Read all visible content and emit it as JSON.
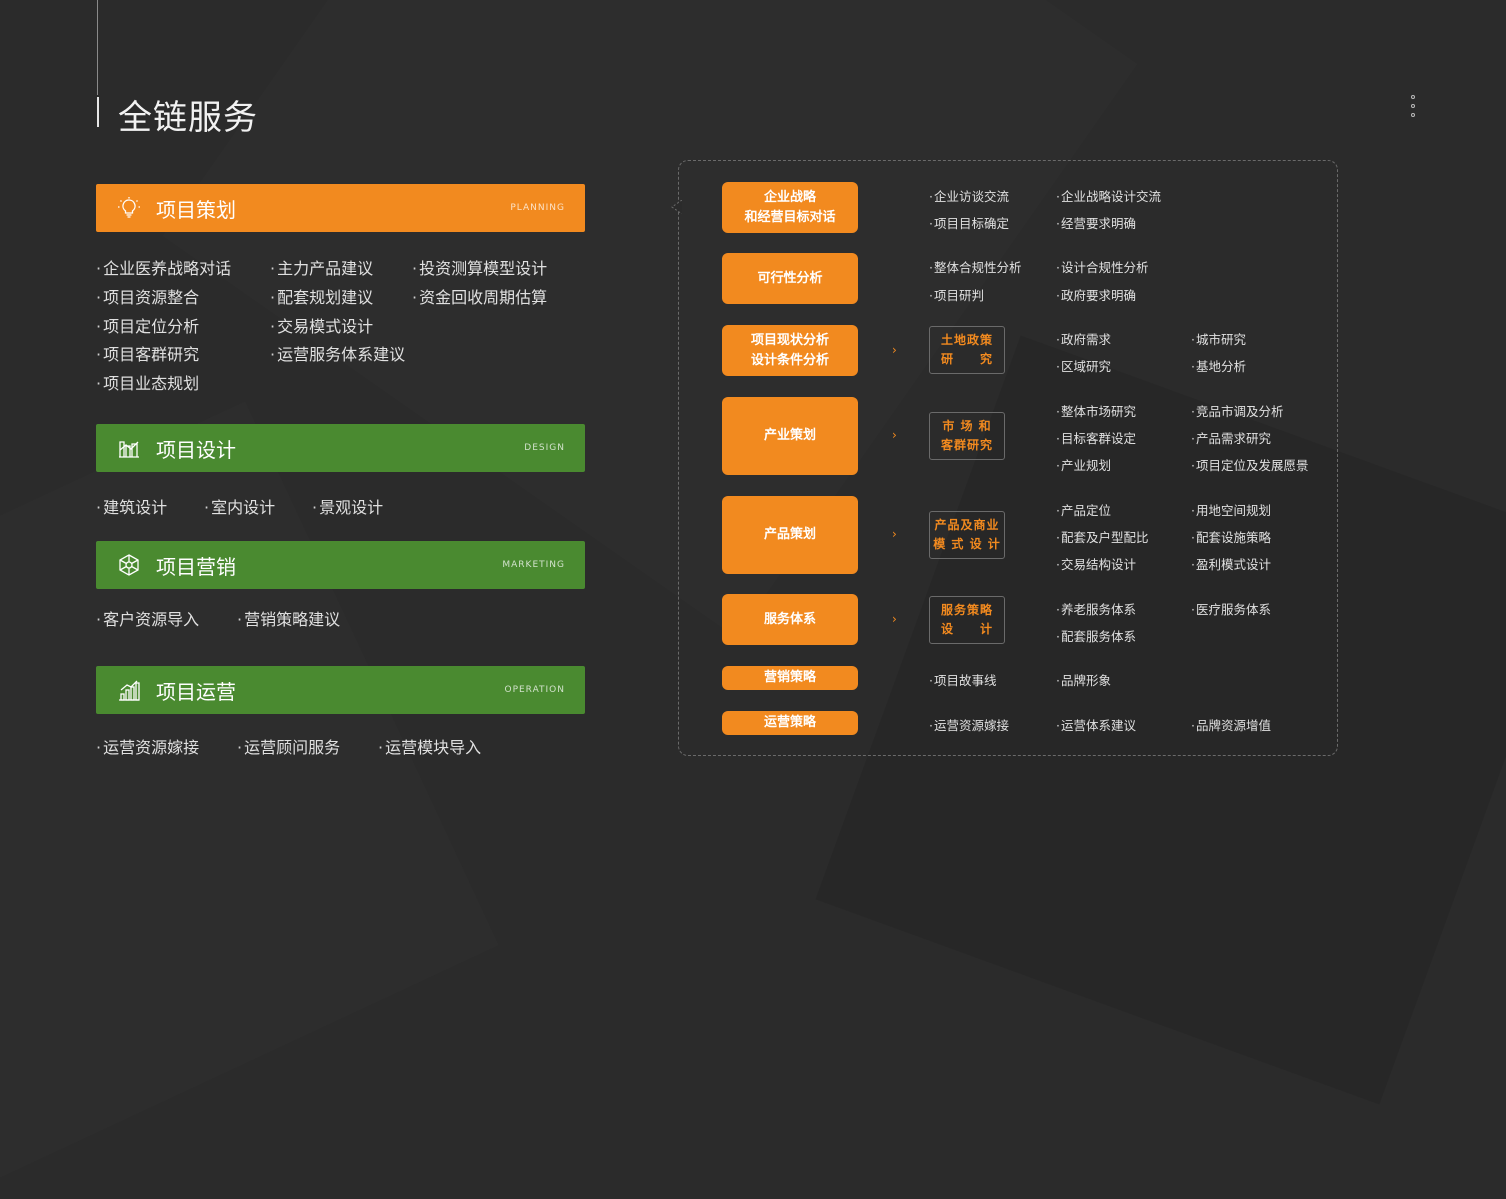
{
  "page": {
    "title": "全链服务"
  },
  "left": {
    "planning": {
      "title": "项目策划",
      "en": "PLANNING",
      "icon": "lightbulb-icon",
      "items": [
        "企业医养战略对话",
        "主力产品建议",
        "投资测算模型设计",
        "项目资源整合",
        "配套规划建议",
        "资金回收周期估算",
        "项目定位分析",
        "交易模式设计",
        "项目客群研究",
        "运营服务体系建议",
        "项目业态规划"
      ]
    },
    "design": {
      "title": "项目设计",
      "en": "DESIGN",
      "icon": "building-chart-icon",
      "items": [
        "建筑设计",
        "室内设计",
        "景观设计"
      ]
    },
    "marketing": {
      "title": "项目营销",
      "en": "MARKETING",
      "icon": "network-icon",
      "items": [
        "客户资源导入",
        "营销策略建议"
      ]
    },
    "operation": {
      "title": "项目运营",
      "en": "OPERATION",
      "icon": "bar-chart-icon",
      "items": [
        "运营资源嫁接",
        "运营顾问服务",
        "运营模块导入"
      ]
    }
  },
  "right": {
    "rows": [
      {
        "box": "企业战略\n和经营目标对话",
        "items": [
          "企业访谈交流",
          "企业战略设计交流",
          "项目目标确定",
          "经营要求明确"
        ]
      },
      {
        "box": "可行性分析",
        "items": [
          "整体合规性分析",
          "设计合规性分析",
          "项目研判",
          "政府要求明确"
        ]
      },
      {
        "box": "项目现状分析\n设计条件分析",
        "sub": "土地政策\n研　　究",
        "items": [
          "政府需求",
          "城市研究",
          "区域研究",
          "基地分析"
        ]
      },
      {
        "box": "产业策划",
        "sub": "市 场 和\n客群研究",
        "items": [
          "整体市场研究",
          "竞品市调及分析",
          "目标客群设定",
          "产品需求研究",
          "产业规划",
          "项目定位及发展愿景"
        ]
      },
      {
        "box": "产品策划",
        "sub": "产品及商业\n模 式 设 计",
        "items": [
          "产品定位",
          "用地空间规划",
          "配套及户型配比",
          "配套设施策略",
          "交易结构设计",
          "盈利模式设计"
        ]
      },
      {
        "box": "服务体系",
        "sub": "服务策略\n设　　计",
        "items": [
          "养老服务体系",
          "医疗服务体系",
          "配套服务体系"
        ]
      },
      {
        "box": "营销策略",
        "items": [
          "项目故事线",
          "品牌形象"
        ]
      },
      {
        "box": "运营策略",
        "items": [
          "运营资源嫁接",
          "运营体系建议",
          "品牌资源增值"
        ]
      }
    ]
  },
  "colors": {
    "orange": "#f28a1f",
    "green": "#4a8a30",
    "background": "#2b2b2b"
  }
}
